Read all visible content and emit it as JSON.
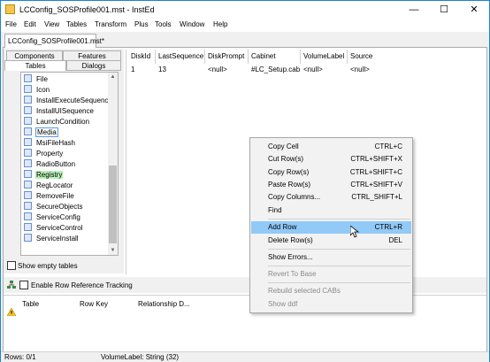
{
  "window": {
    "title": "LCConfig_SOSProfile001.mst - InstEd",
    "minimize": "—",
    "maximize": "☐",
    "close": "✕"
  },
  "menu": [
    "File",
    "Edit",
    "View",
    "Tables",
    "Transform",
    "Plus",
    "Tools",
    "Window",
    "Help"
  ],
  "doc_tab": "LCConfig_SOSProfile001.mst*",
  "panel_tabs": {
    "components": "Components",
    "features": "Features",
    "tables": "Tables",
    "dialogs": "Dialogs"
  },
  "tables": [
    "File",
    "Icon",
    "InstallExecuteSequence",
    "InstallUISequence",
    "LaunchCondition",
    "Media",
    "MsiFileHash",
    "Property",
    "RadioButton",
    "Registry",
    "RegLocator",
    "RemoveFile",
    "SecureObjects",
    "ServiceConfig",
    "ServiceControl",
    "ServiceInstall"
  ],
  "show_empty_tables": "Show empty tables",
  "grid": {
    "columns": [
      "DiskId",
      "LastSequence",
      "DiskPrompt",
      "Cabinet",
      "VolumeLabel",
      "Source"
    ],
    "rows": [
      [
        "1",
        "13",
        "<null>",
        "#LC_Setup.cab",
        "<null>",
        "<null>"
      ]
    ]
  },
  "row_ref": {
    "label": "Enable Row Reference Tracking"
  },
  "ref_columns": [
    "Table",
    "Row Key",
    "Relationship D..."
  ],
  "status": {
    "rows": "Rows: 0/1",
    "field": "VolumeLabel: String (32)"
  },
  "context_menu": {
    "items": [
      {
        "label": "Copy Cell",
        "key": "CTRL+C"
      },
      {
        "label": "Cut Row(s)",
        "key": "CTRL+SHIFT+X"
      },
      {
        "label": "Copy Row(s)",
        "key": "CTRL+SHIFT+C"
      },
      {
        "label": "Paste Row(s)",
        "key": "CTRL+SHIFT+V"
      },
      {
        "label": "Copy Columns...",
        "key": "CTRL_SHIFT+L"
      },
      {
        "label": "Find",
        "key": ""
      },
      {
        "label": "Add Row",
        "key": "CTRL+R"
      },
      {
        "label": "Delete Row(s)",
        "key": "DEL"
      },
      {
        "label": "Show  Errors...",
        "key": ""
      },
      {
        "label": "Revert To Base",
        "key": ""
      },
      {
        "label": "Rebuild selected CABs",
        "key": ""
      },
      {
        "label": "Show ddf",
        "key": ""
      }
    ]
  },
  "colors": {
    "accent": "#1883d7",
    "hover": "#91c9f7",
    "selected_table": "#b6f0b6"
  },
  "icons": {
    "app": "installer-icon",
    "table": "table-icon",
    "warning": "warning-icon",
    "tree": "tree-icon",
    "cursor": "mouse-cursor-icon"
  }
}
